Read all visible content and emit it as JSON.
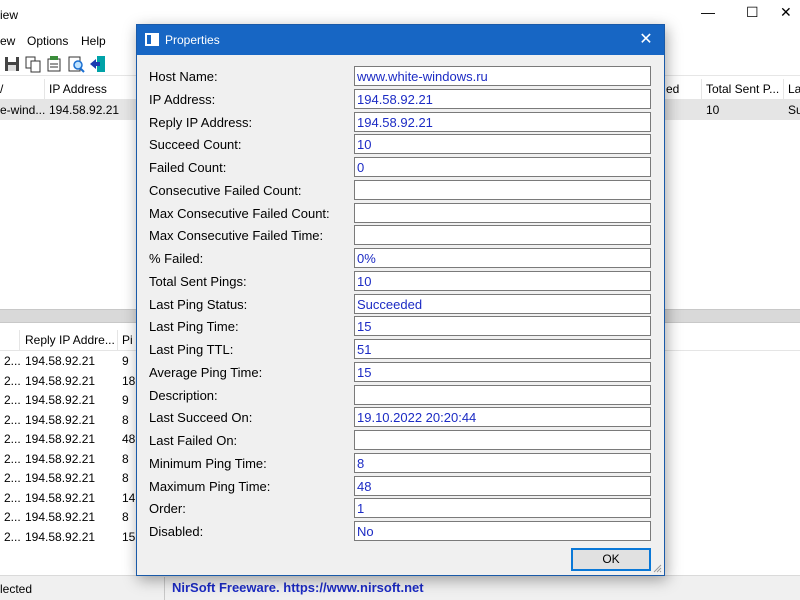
{
  "main_window": {
    "title_partial": "iew",
    "menu": [
      "ew",
      "Options",
      "Help"
    ],
    "upper_header": [
      "IP Address",
      "ed",
      "Total Sent P...",
      "La"
    ],
    "upper_row": [
      "e-wind...",
      "194.58.92.21",
      "10",
      "Su"
    ],
    "lower_header": [
      "Reply IP Addre...",
      "Pi"
    ],
    "lower_rows": [
      {
        "c0": "2...",
        "ip": "194.58.92.21",
        "v": "9"
      },
      {
        "c0": "2...",
        "ip": "194.58.92.21",
        "v": "18"
      },
      {
        "c0": "2...",
        "ip": "194.58.92.21",
        "v": "9"
      },
      {
        "c0": "2...",
        "ip": "194.58.92.21",
        "v": "8"
      },
      {
        "c0": "2...",
        "ip": "194.58.92.21",
        "v": "48"
      },
      {
        "c0": "2...",
        "ip": "194.58.92.21",
        "v": "8"
      },
      {
        "c0": "2...",
        "ip": "194.58.92.21",
        "v": "8"
      },
      {
        "c0": "2...",
        "ip": "194.58.92.21",
        "v": "14"
      },
      {
        "c0": "2...",
        "ip": "194.58.92.21",
        "v": "8"
      },
      {
        "c0": "2...",
        "ip": "194.58.92.21",
        "v": "15"
      }
    ],
    "status_left": "lected",
    "status_right": "NirSoft Freeware. https://www.nirsoft.net"
  },
  "dialog": {
    "title": "Properties",
    "ok_label": "OK",
    "properties": [
      {
        "label": "Host Name:",
        "value": "www.white-windows.ru"
      },
      {
        "label": "IP Address:",
        "value": "194.58.92.21"
      },
      {
        "label": "Reply IP Address:",
        "value": "194.58.92.21"
      },
      {
        "label": "Succeed Count:",
        "value": "10"
      },
      {
        "label": "Failed Count:",
        "value": "0"
      },
      {
        "label": "Consecutive Failed Count:",
        "value": ""
      },
      {
        "label": "Max Consecutive Failed Count:",
        "value": ""
      },
      {
        "label": "Max Consecutive Failed Time:",
        "value": ""
      },
      {
        "label": "% Failed:",
        "value": "0%"
      },
      {
        "label": "Total Sent Pings:",
        "value": "10"
      },
      {
        "label": "Last Ping Status:",
        "value": "Succeeded"
      },
      {
        "label": "Last Ping Time:",
        "value": "15"
      },
      {
        "label": "Last Ping TTL:",
        "value": "51"
      },
      {
        "label": "Average Ping Time:",
        "value": "15"
      },
      {
        "label": "Description:",
        "value": ""
      },
      {
        "label": "Last Succeed On:",
        "value": "19.10.2022 20:20:44"
      },
      {
        "label": "Last Failed On:",
        "value": ""
      },
      {
        "label": "Minimum Ping Time:",
        "value": "8"
      },
      {
        "label": "Maximum Ping Time:",
        "value": "48"
      },
      {
        "label": "Order:",
        "value": "1"
      },
      {
        "label": "Disabled:",
        "value": "No"
      }
    ]
  },
  "colors": {
    "dialog_title_bg": "#1766c4",
    "value_text": "#1c2bc4",
    "ok_border": "#0a78d7"
  }
}
